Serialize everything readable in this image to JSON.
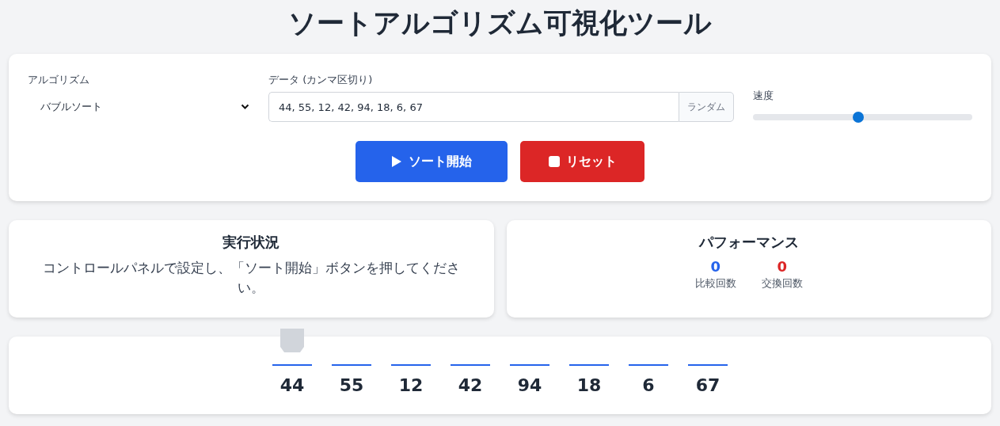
{
  "title": "ソートアルゴリズム可視化ツール",
  "controls": {
    "algorithm": {
      "label": "アルゴリズム",
      "value": "バブルソート"
    },
    "data": {
      "label": "データ (カンマ区切り)",
      "value": "44, 55, 12, 42, 94, 18, 6, 67",
      "button": "ランダム"
    },
    "speed": {
      "label": "速度",
      "level": 0.48
    },
    "buttons": [
      {
        "kind": "start",
        "label": "ソート開始"
      },
      {
        "kind": "reset",
        "label": "リセット"
      }
    ]
  },
  "status": {
    "title": "実行状況",
    "message": "コントロールパネルで設定し、「ソート開始」ボタンを押してください。"
  },
  "performance": {
    "title": "パフォーマンス",
    "stats": [
      {
        "value": "0",
        "label": "比較回数",
        "color": "#2563eb"
      },
      {
        "value": "0",
        "label": "交換回数",
        "color": "#dc2626"
      }
    ]
  },
  "array": [
    {
      "value": "44",
      "selected": true
    },
    {
      "value": "55",
      "selected": false
    },
    {
      "value": "12",
      "selected": false
    },
    {
      "value": "42",
      "selected": false
    },
    {
      "value": "94",
      "selected": false
    },
    {
      "value": "18",
      "selected": false
    },
    {
      "value": "6",
      "selected": false
    },
    {
      "value": "67",
      "selected": false
    }
  ]
}
